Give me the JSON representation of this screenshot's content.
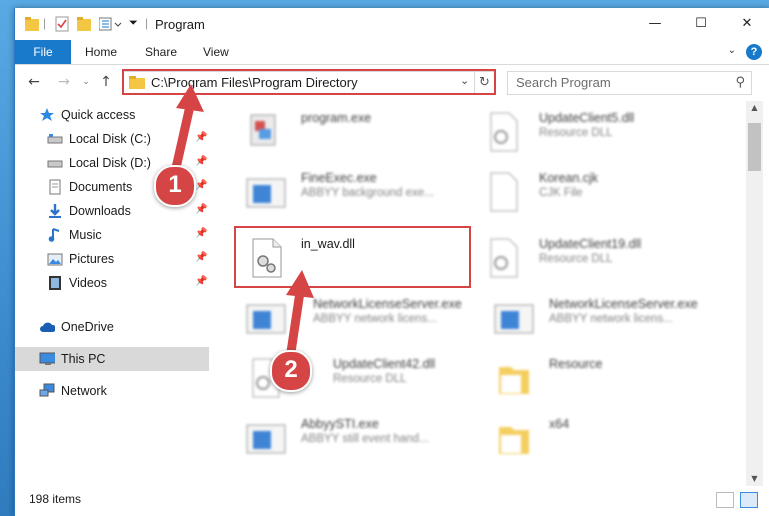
{
  "window": {
    "title": "Program",
    "minimize": "—",
    "maximize": "☐",
    "close": "✕"
  },
  "ribbon": {
    "tabs": [
      "File",
      "Home",
      "Share",
      "View"
    ],
    "help": "?"
  },
  "navbar": {
    "back": "←",
    "forward": "→",
    "up": "↑",
    "address": "C:\\Program Files\\Program Directory",
    "search_placeholder": "Search Program"
  },
  "sidebar": {
    "items": [
      {
        "label": "Quick access",
        "icon": "star-icon"
      },
      {
        "label": "Local Disk (C:)",
        "icon": "drive-icon",
        "pinned": true
      },
      {
        "label": "Local Disk (D:)",
        "icon": "drive-icon",
        "pinned": true
      },
      {
        "label": "Documents",
        "icon": "documents-icon",
        "pinned": true
      },
      {
        "label": "Downloads",
        "icon": "download-icon",
        "pinned": true
      },
      {
        "label": "Music",
        "icon": "music-icon",
        "pinned": true
      },
      {
        "label": "Pictures",
        "icon": "pictures-icon",
        "pinned": true
      },
      {
        "label": "Videos",
        "icon": "videos-icon",
        "pinned": true
      },
      {
        "label": "OneDrive",
        "icon": "cloud-icon"
      },
      {
        "label": "This PC",
        "icon": "computer-icon",
        "selected": true
      },
      {
        "label": "Network",
        "icon": "network-icon"
      }
    ]
  },
  "files": [
    {
      "name": "program.exe",
      "type": ""
    },
    {
      "name": "UpdateClient5.dll",
      "type": "Resource DLL"
    },
    {
      "name": "FineExec.exe",
      "type": "ABBYY background exe..."
    },
    {
      "name": "Korean.cjk",
      "type": "CJK File"
    },
    {
      "name": "in_wav.dll",
      "type": ""
    },
    {
      "name": "UpdateClient19.dll",
      "type": "Resource DLL"
    },
    {
      "name": "NetworkLicenseServer.exe",
      "type": "ABBYY network licens..."
    },
    {
      "name": "NetworkLicenseServer.exe",
      "type": "ABBYY network licens..."
    },
    {
      "name": "UpdateClient42.dll",
      "type": "Resource DLL"
    },
    {
      "name": "Resource",
      "type": ""
    },
    {
      "name": "AbbyySTI.exe",
      "type": "ABBYY still event hand..."
    },
    {
      "name": "x64",
      "type": ""
    }
  ],
  "status": {
    "count": "198 items"
  },
  "annotations": {
    "step1": "1",
    "step2": "2",
    "highlight_color": "#d64545"
  },
  "colors": {
    "accent": "#1979ca",
    "selection": "#d9d9d9"
  }
}
